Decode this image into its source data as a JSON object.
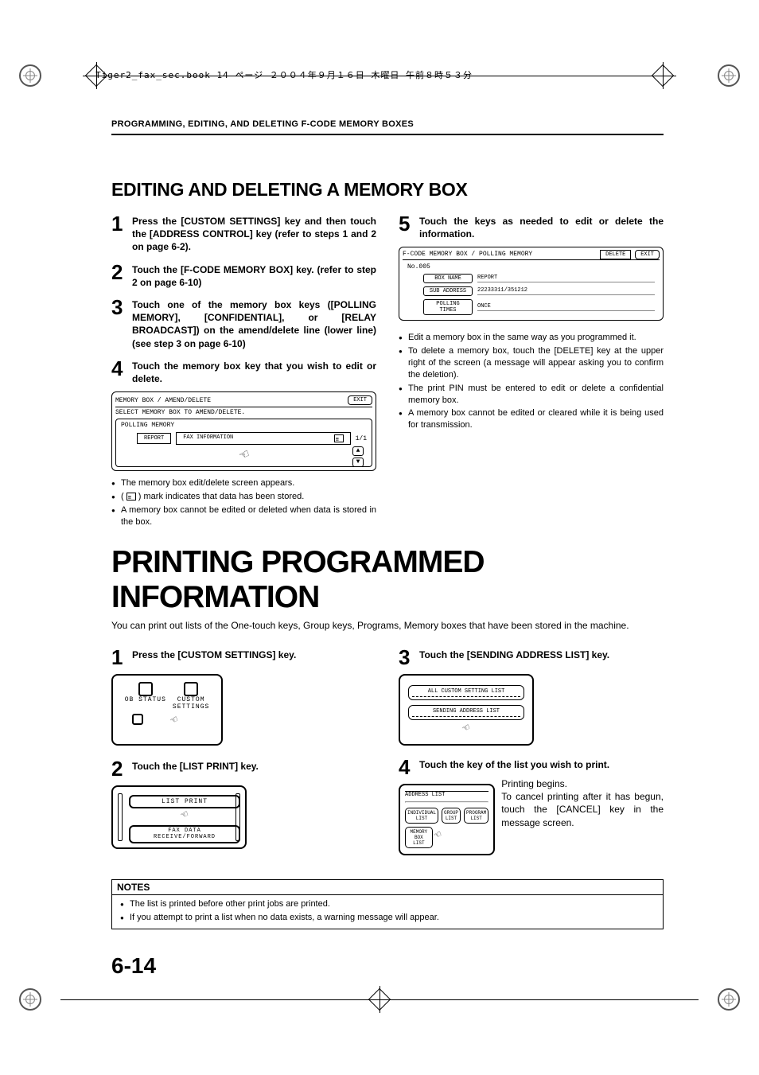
{
  "meta": {
    "book_mark": "Tiger2_fax_sec.book  14 ページ  ２００４年９月１６日  木曜日  午前８時５３分",
    "running_head": "PROGRAMMING, EDITING, AND DELETING F-CODE MEMORY BOXES",
    "page_number": "6-14"
  },
  "section1": {
    "title": "EDITING AND DELETING A MEMORY BOX",
    "steps_left": [
      {
        "n": "1",
        "t": "Press the [CUSTOM SETTINGS] key and then touch the [ADDRESS CONTROL] key (refer to steps 1 and 2 on page 6-2)."
      },
      {
        "n": "2",
        "t": "Touch the [F-CODE MEMORY BOX] key. (refer to step 2 on page 6-10)"
      },
      {
        "n": "3",
        "t": "Touch one of the memory box keys ([POLLING MEMORY], [CONFIDENTIAL], or [RELAY BROADCAST]) on the amend/delete line (lower line) (see step 3 on page 6-10)"
      },
      {
        "n": "4",
        "t": "Touch the memory box key that you wish to edit or delete."
      }
    ],
    "panel4": {
      "title": "MEMORY BOX / AMEND/DELETE",
      "exit": "EXIT",
      "subtitle": "SELECT MEMORY BOX TO AMEND/DELETE.",
      "category": "POLLING MEMORY",
      "item": "REPORT",
      "fax": "FAX INFORMATION",
      "page": "1/1"
    },
    "bullets4": [
      "The memory box edit/delete screen appears.",
      "(      ) mark indicates that data has been stored.",
      "A memory box cannot be edited or deleted when data is stored in the box."
    ],
    "steps_right": [
      {
        "n": "5",
        "t": "Touch the keys as needed to edit or delete the information."
      }
    ],
    "panel5": {
      "title": "F-CODE MEMORY BOX / POLLING MEMORY",
      "delete": "DELETE",
      "exit": "EXIT",
      "no": "No.005",
      "box_name_label": "BOX NAME",
      "box_name_val": "REPORT",
      "sub_addr_label": "SUB ADDRESS",
      "sub_addr_val": "22233311/351212",
      "poll_label": "POLLING TIMES",
      "poll_val": "ONCE"
    },
    "bullets5": [
      "Edit a memory box in the same way as you programmed it.",
      "To delete a memory box, touch the [DELETE] key at the upper right of the screen (a message will appear asking you to confirm the deletion).",
      "The print PIN must be entered to edit or delete a confidential memory box.",
      "A memory box cannot be edited or cleared while it is being used for transmission."
    ]
  },
  "section2": {
    "title": "PRINTING PROGRAMMED INFORMATION",
    "intro": "You can print out lists of the One-touch keys, Group keys, Programs, Memory boxes that have been stored in the machine.",
    "left": [
      {
        "n": "1",
        "t": "Press the [CUSTOM SETTINGS] key."
      },
      {
        "n": "2",
        "t": "Touch the [LIST PRINT] key."
      }
    ],
    "shot1": {
      "status": "OB STATUS",
      "custom": "CUSTOM\nSETTINGS"
    },
    "shot2": {
      "listprint": "LIST PRINT",
      "fax": "FAX DATA\nRECEIVE/FORWARD"
    },
    "right": [
      {
        "n": "3",
        "t": "Touch the [SENDING ADDRESS LIST] key."
      },
      {
        "n": "4",
        "t": "Touch the key of the list you wish to print."
      }
    ],
    "shot3": {
      "all": "ALL CUSTOM SETTING LIST",
      "send": "SENDING ADDRESS LIST"
    },
    "shot4": {
      "title": "ADDRESS LIST",
      "buttons": [
        "INDIVIDUAL LIST",
        "GROUP LIST",
        "PROGRAM LIST",
        "MEMORY BOX LIST"
      ]
    },
    "right_text": "Printing begins.\nTo cancel printing after it has begun, touch the [CANCEL] key in the message screen."
  },
  "notes": {
    "title": "NOTES",
    "items": [
      "The list is printed before other print jobs are printed.",
      "If you attempt to print a list when no data exists, a warning message will appear."
    ]
  }
}
